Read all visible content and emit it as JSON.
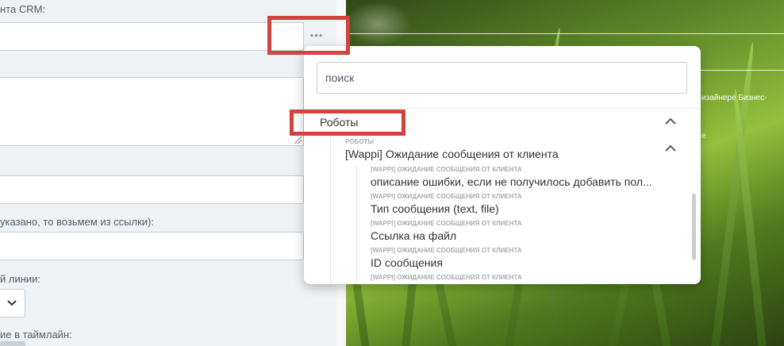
{
  "form": {
    "crm_label": "нта CRM:",
    "url_hint_label": "указано, то возьмем из ссылки):",
    "line_label": "й линии:",
    "timeline_label": "ие в таймлайн:"
  },
  "background": {
    "side_text_1": "изайнере Бизнес-",
    "side_text_2": "е"
  },
  "popup": {
    "search_placeholder": "поиск",
    "group": {
      "title": "Роботы",
      "robot_caption": "РОБОТЫ",
      "robot_title": "[Wappi] Ожидание сообщения от клиента",
      "items": [
        {
          "caption": "[WAPPI] ОЖИДАНИЕ СООБЩЕНИЯ ОТ КЛИЕНТА",
          "label": "описание ошибки, если не получилось добавить пол..."
        },
        {
          "caption": "[WAPPI] ОЖИДАНИЕ СООБЩЕНИЯ ОТ КЛИЕНТА",
          "label": "Тип сообщения (text, file)"
        },
        {
          "caption": "[WAPPI] ОЖИДАНИЕ СООБЩЕНИЯ ОТ КЛИЕНТА",
          "label": "Ссылка на файл"
        },
        {
          "caption": "[WAPPI] ОЖИДАНИЕ СООБЩЕНИЯ ОТ КЛИЕНТА",
          "label": "ID сообщения"
        },
        {
          "caption": "[WAPPI] ОЖИДАНИЕ СООБЩЕНИЯ ОТ КЛИЕНТА",
          "label": ""
        }
      ]
    }
  },
  "colors": {
    "annotation": "#d0433f",
    "form_bg": "#eef2f4"
  },
  "icons": {
    "more": "more-dots-icon",
    "collapse": "chevron-up-icon",
    "select": "chevron-down-icon"
  }
}
